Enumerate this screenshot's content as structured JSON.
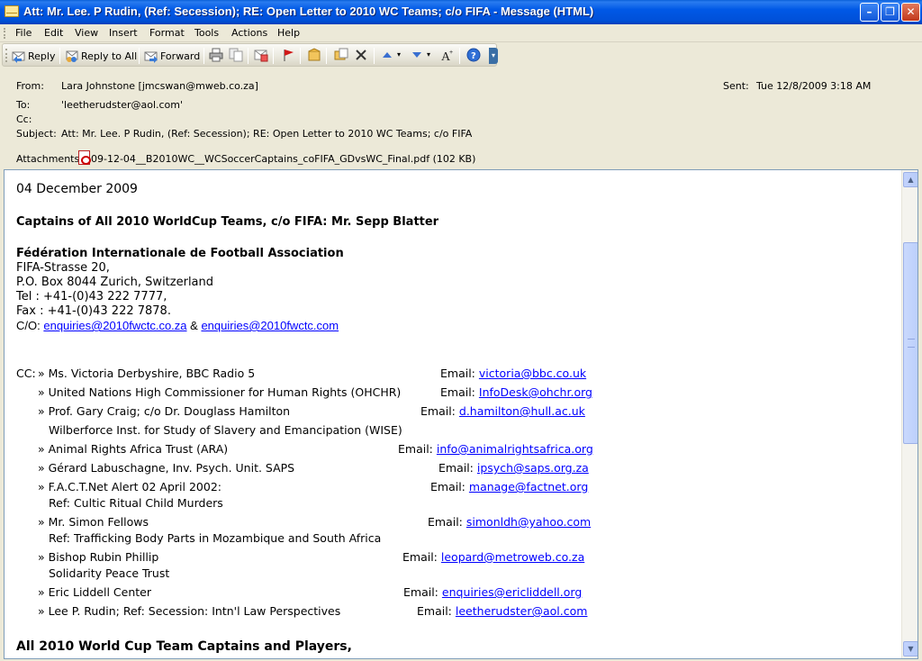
{
  "window": {
    "title": "Att: Mr. Lee. P Rudin, (Ref: Secession); RE: Open Letter to 2010 WC Teams; c/o FIFA - Message (HTML)"
  },
  "menu": [
    "File",
    "Edit",
    "View",
    "Insert",
    "Format",
    "Tools",
    "Actions",
    "Help"
  ],
  "toolbar": {
    "reply": "Reply",
    "reply_all": "Reply to All",
    "forward": "Forward"
  },
  "header": {
    "from_label": "From:",
    "from_value": "Lara Johnstone [jmcswan@mweb.co.za]",
    "sent_label": "Sent:",
    "sent_value": "Tue 12/8/2009 3:18 AM",
    "to_label": "To:",
    "to_value": "'leetherudster@aol.com'",
    "cc_label": "Cc:",
    "cc_value": "",
    "subject_label": "Subject:",
    "subject_value": "Att: Mr. Lee. P Rudin, (Ref: Secession); RE: Open Letter to 2010 WC Teams; c/o FIFA",
    "attachments_label": "Attachments:",
    "attachment_name": "09-12-04__B2010WC__WCSoccerCaptains_coFIFA_GDvsWC_Final.pdf (102 KB)"
  },
  "message": {
    "date": "04 December 2009",
    "heading": "Captains of All 2010 WorldCup Teams, c/o FIFA: Mr. Sepp Blatter",
    "org_name": "Fédération Internationale de Football Association",
    "addr1": "FIFA-Strasse 20,",
    "addr2": "P.O. Box 8044 Zurich, Switzerland",
    "tel": "Tel : +41-(0)43 222 7777,",
    "fax": "Fax : +41-(0)43 222 7878.",
    "co_label": "C/O:",
    "co_link1": "enquiries@2010fwctc.co.za",
    "co_amp": "&",
    "co_link2": "enquiries@2010fwctc.com",
    "cc_prefix": "CC:",
    "email_label": "Email:",
    "cc_entries": [
      {
        "name": "Ms. Victoria Derbyshire, BBC Radio 5",
        "email": "victoria@bbc.co.uk"
      },
      {
        "name": "United Nations High Commissioner for Human Rights (OHCHR)",
        "email": "InfoDesk@ohchr.org"
      },
      {
        "name": "Prof. Gary Craig; c/o Dr. Douglass Hamilton",
        "sub": "Wilberforce Inst. for Study of Slavery and Emancipation (WISE)",
        "email": "d.hamilton@hull.ac.uk"
      },
      {
        "name": "Animal Rights Africa Trust (ARA)",
        "email": "info@animalrightsafrica.org"
      },
      {
        "name": "Gérard Labuschagne, Inv. Psych. Unit. SAPS",
        "email": "ipsych@saps.org.za"
      },
      {
        "name": "F.A.C.T.Net Alert 02 April 2002:",
        "sub": "Ref: Cultic Ritual Child Murders",
        "email": "manage@factnet.org"
      },
      {
        "name": "Mr. Simon Fellows",
        "sub": "Ref: Trafficking Body Parts in Mozambique and South Africa",
        "email": "simonldh@yahoo.com"
      },
      {
        "name": "Bishop Rubin Phillip",
        "sub": "Solidarity Peace Trust",
        "email": "leopard@metroweb.co.za"
      },
      {
        "name": "Eric Liddell Center",
        "email": "enquiries@ericliddell.org"
      },
      {
        "name": "Lee P. Rudin; Ref: Secession: Intn'l Law Perspectives",
        "email": "leetherudster@aol.com"
      }
    ],
    "closing_heading": "All 2010 World Cup Team Captains and Players,"
  }
}
